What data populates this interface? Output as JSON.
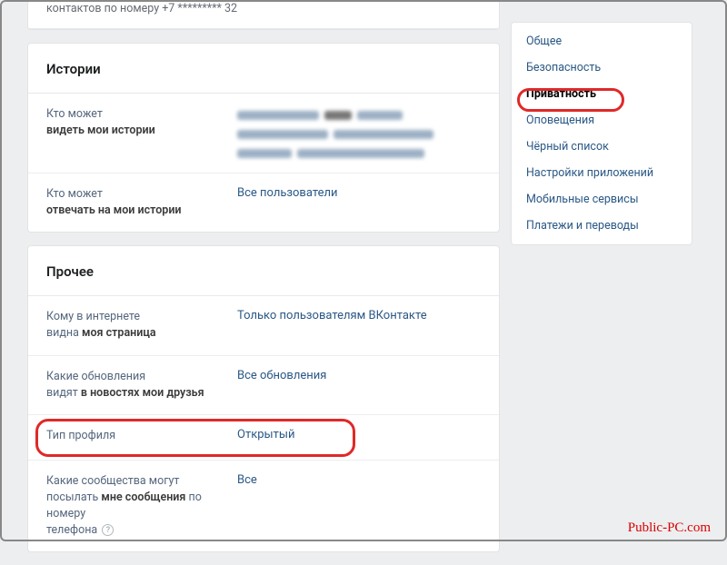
{
  "top_remainder": "контактов по номеру +7 ********* 32",
  "stories": {
    "header": "Истории",
    "row1": {
      "line1": "Кто может",
      "line2_bold": "видеть мои истории"
    },
    "row2": {
      "line1": "Кто может",
      "line2_bold": "отвечать на мои истории",
      "value": "Все пользователи"
    }
  },
  "other": {
    "header": "Прочее",
    "row1": {
      "line1": "Кому в интернете",
      "line2_pre": "видна ",
      "line2_bold": "моя страница",
      "value": "Только пользователям ВКонтакте"
    },
    "row2": {
      "line1": "Какие обновления",
      "line2_pre": "видят ",
      "line2_bold": "в новостях мои друзья",
      "value": "Все обновления"
    },
    "row3": {
      "line1": "Тип профиля",
      "value": "Открытый"
    },
    "row4": {
      "line1": "Какие сообщества могут",
      "line2_pre": "посылать ",
      "line2_bold": "мне сообщения",
      "line2_post": " по номеру",
      "line3": "телефона",
      "value": "Все"
    }
  },
  "sidebar": {
    "items": [
      "Общее",
      "Безопасность",
      "Приватность",
      "Оповещения",
      "Чёрный список",
      "Настройки приложений",
      "Мобильные сервисы",
      "Платежи и переводы"
    ]
  },
  "watermark": "Public-PC.com"
}
